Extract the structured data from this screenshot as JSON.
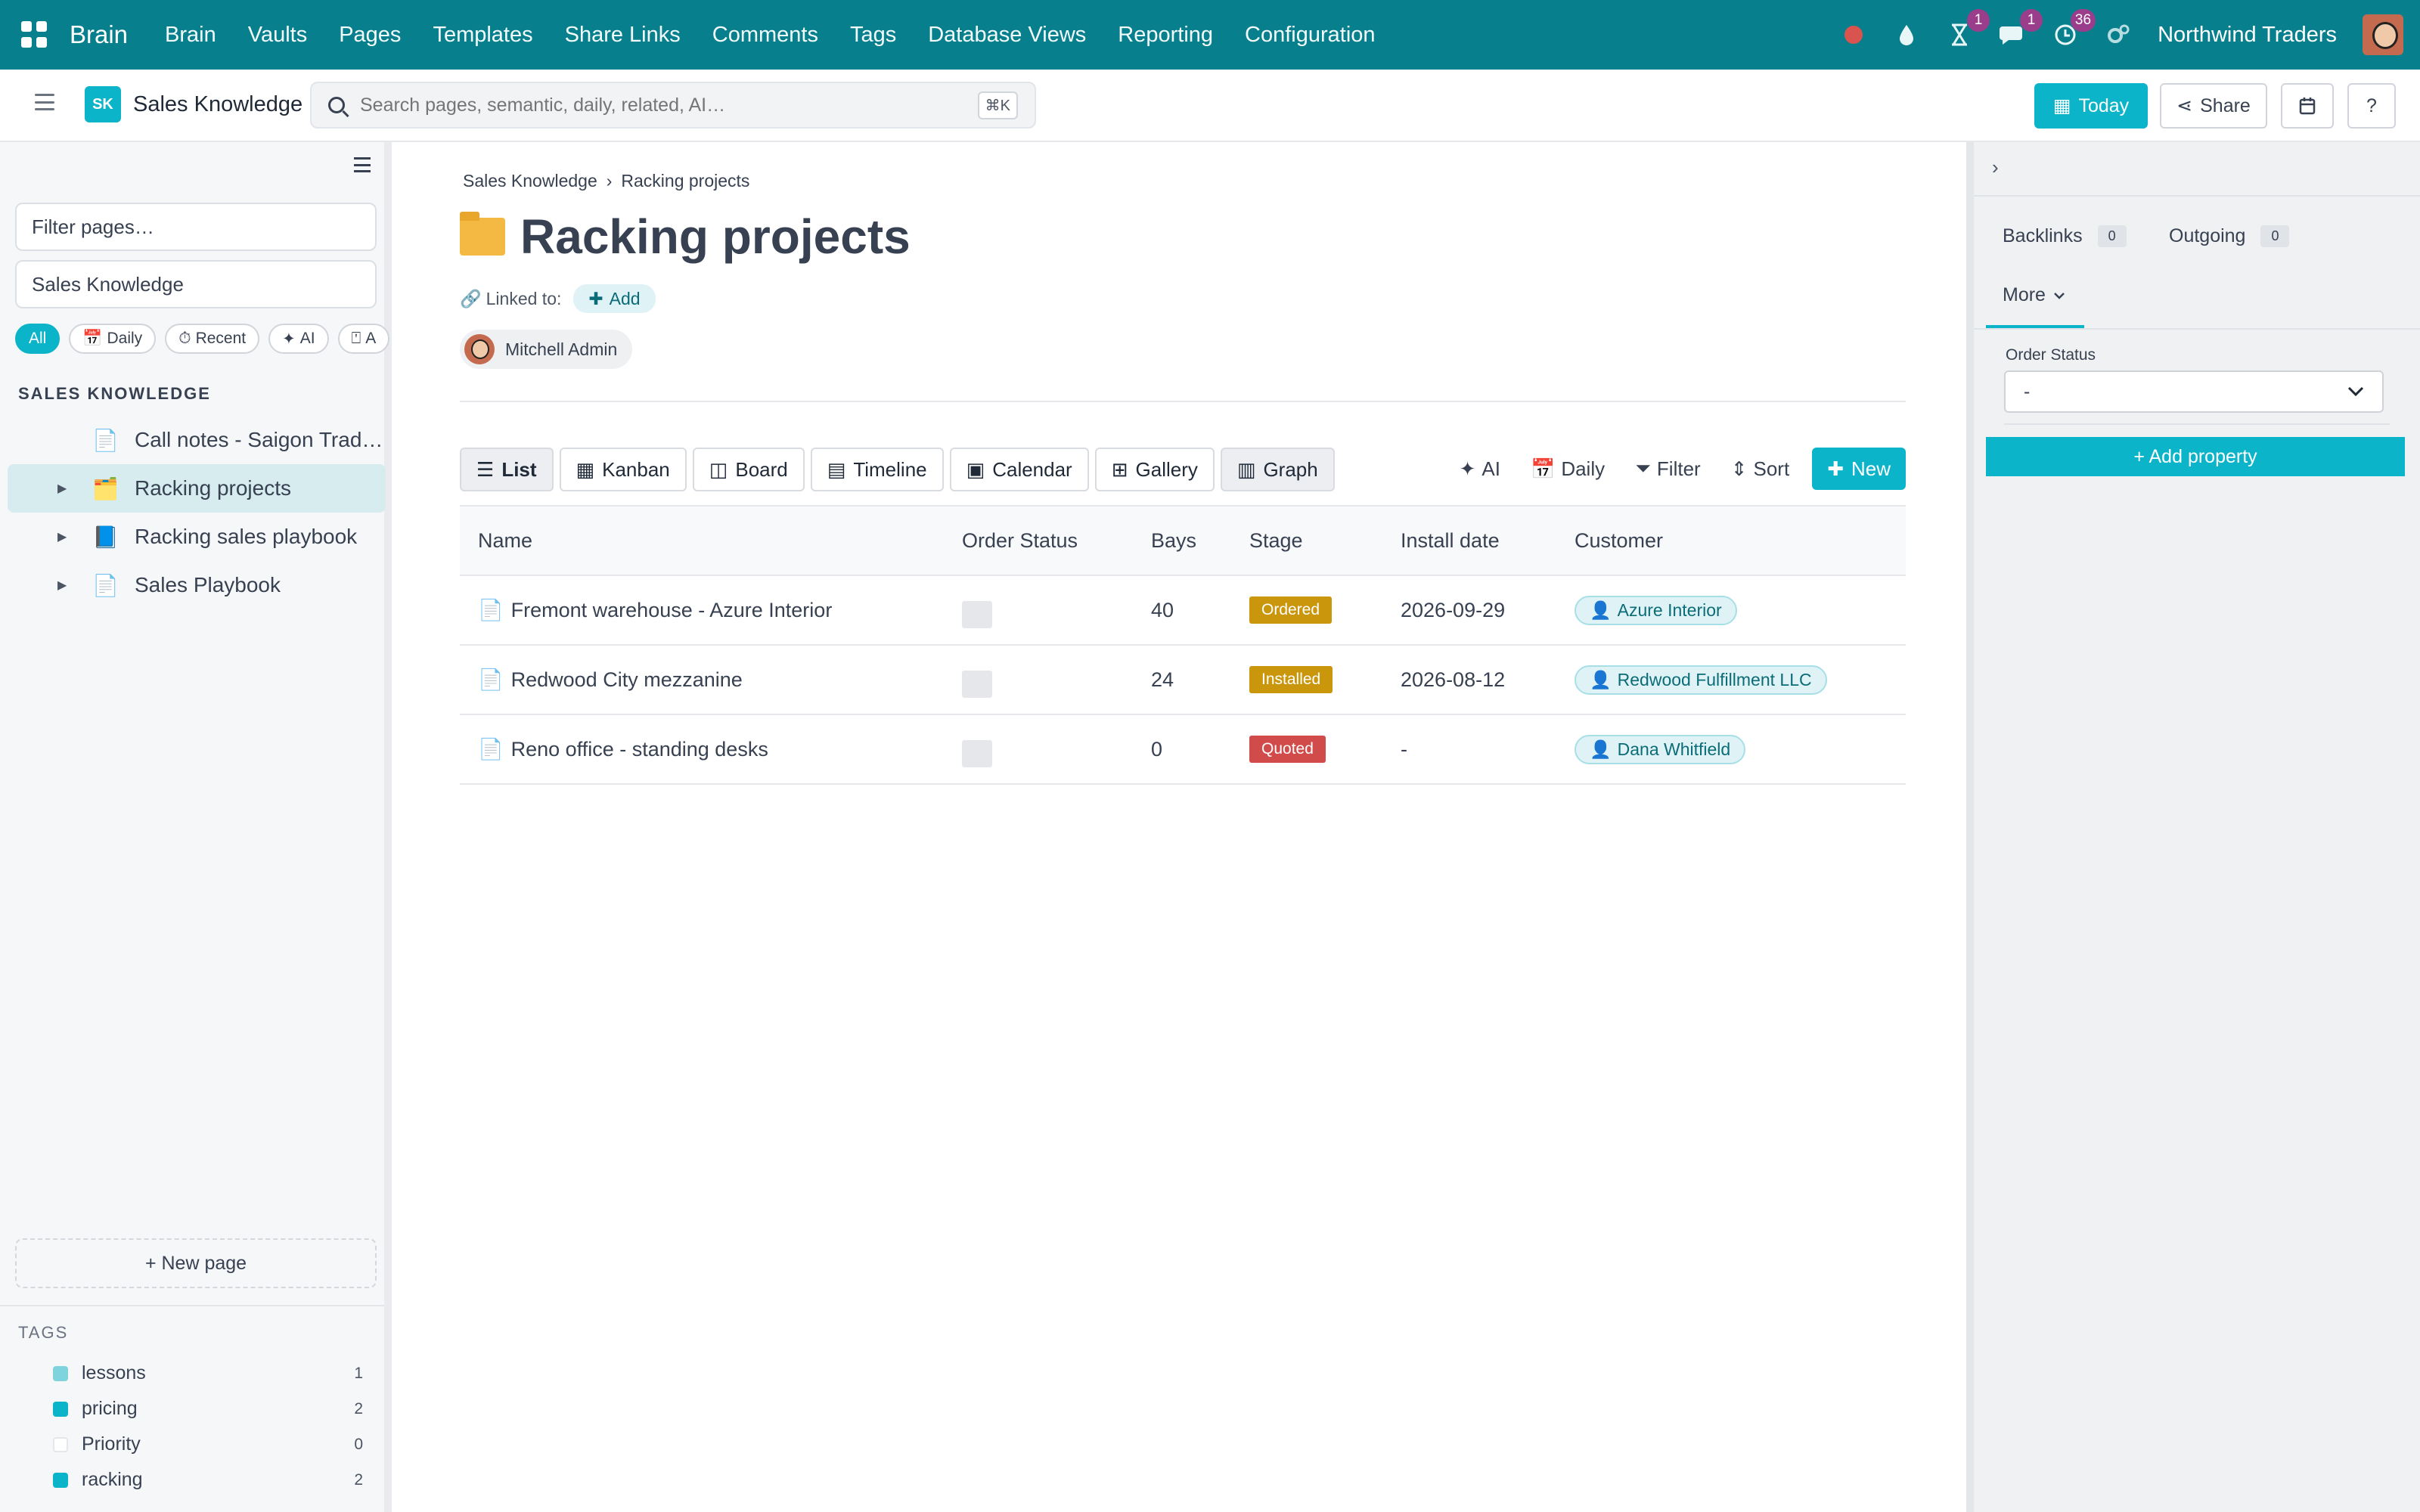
{
  "topnav": {
    "brand": "Brain",
    "items": [
      "Brain",
      "Vaults",
      "Pages",
      "Templates",
      "Share Links",
      "Comments",
      "Tags",
      "Database Views",
      "Reporting",
      "Configuration"
    ],
    "activity_badge": "1",
    "chat_badge": "1",
    "clock_badge": "36",
    "company": "Northwind Traders"
  },
  "subheader": {
    "vault_initials": "SK",
    "vault_name": "Sales Knowledge",
    "search_placeholder": "Search pages, semantic, daily, related, AI…",
    "search_shortcut": "⌘K",
    "today_label": "Today",
    "share_label": "Share",
    "help_label": "?"
  },
  "sidebar": {
    "filter_placeholder": "Filter pages…",
    "vault_select": "Sales Knowledge",
    "chips": [
      {
        "label": "All"
      },
      {
        "icon": "📅",
        "label": "Daily"
      },
      {
        "icon": "⏱",
        "label": "Recent"
      },
      {
        "icon": "✦",
        "label": "AI"
      },
      {
        "icon": "⍞",
        "label": "A"
      }
    ],
    "section_title": "SALES KNOWLEDGE",
    "tree": [
      {
        "icon": "📄",
        "label": "Call notes - Saigon Tradi…",
        "has_children": false
      },
      {
        "icon": "🗂️",
        "label": "Racking projects",
        "has_children": true
      },
      {
        "icon": "📘",
        "label": "Racking sales playbook",
        "has_children": true
      },
      {
        "icon": "📄",
        "label": "Sales Playbook",
        "has_children": true
      }
    ],
    "new_page_label": "+ New page",
    "tags_title": "TAGS",
    "tags": [
      {
        "name": "lessons",
        "count": "1",
        "color": "#7fd3dd"
      },
      {
        "name": "pricing",
        "count": "2",
        "color": "#0bb4c8"
      },
      {
        "name": "Priority",
        "count": "0",
        "color": "#ffffff"
      },
      {
        "name": "racking",
        "count": "2",
        "color": "#0bb4c8"
      }
    ]
  },
  "main": {
    "breadcrumb": [
      "Sales Knowledge",
      "Racking projects"
    ],
    "breadcrumb_sep": "›",
    "title": "Racking projects",
    "linked_label": "Linked to:",
    "add_label": "Add",
    "owner": "Mitchell Admin",
    "views": [
      {
        "icon": "☰",
        "label": "List"
      },
      {
        "icon": "▦",
        "label": "Kanban"
      },
      {
        "icon": "◫",
        "label": "Board"
      },
      {
        "icon": "▤",
        "label": "Timeline"
      },
      {
        "icon": "▣",
        "label": "Calendar"
      },
      {
        "icon": "⊞",
        "label": "Gallery"
      },
      {
        "icon": "▥",
        "label": "Graph"
      }
    ],
    "tools": [
      {
        "icon": "✦",
        "label": "AI"
      },
      {
        "icon": "📅",
        "label": "Daily"
      },
      {
        "icon": "⏷",
        "label": "Filter"
      },
      {
        "icon": "⇕",
        "label": "Sort"
      }
    ],
    "new_label": "New",
    "columns": [
      "Name",
      "Order Status",
      "Bays",
      "Stage",
      "Install date",
      "Customer"
    ],
    "rows": [
      {
        "name": "Fremont warehouse - Azure Interior",
        "order_status": "-",
        "bays": "40",
        "stage": "Ordered",
        "stage_color": "#c9960c",
        "install_date": "2026-09-29",
        "customer": "Azure Interior"
      },
      {
        "name": "Redwood City mezzanine",
        "order_status": "-",
        "bays": "24",
        "stage": "Installed",
        "stage_color": "#c9960c",
        "install_date": "2026-08-12",
        "customer": "Redwood Fulfillment LLC"
      },
      {
        "name": "Reno office - standing desks",
        "order_status": "-",
        "bays": "0",
        "stage": "Quoted",
        "stage_color": "#d14b4b",
        "install_date": "-",
        "customer": "Dana Whitfield"
      }
    ]
  },
  "rpanel": {
    "backlinks_label": "Backlinks",
    "backlinks_count": "0",
    "outgoing_label": "Outgoing",
    "outgoing_count": "0",
    "more_label": "More",
    "property_label": "Order Status",
    "property_value": "-",
    "add_property_label": "+ Add property"
  }
}
